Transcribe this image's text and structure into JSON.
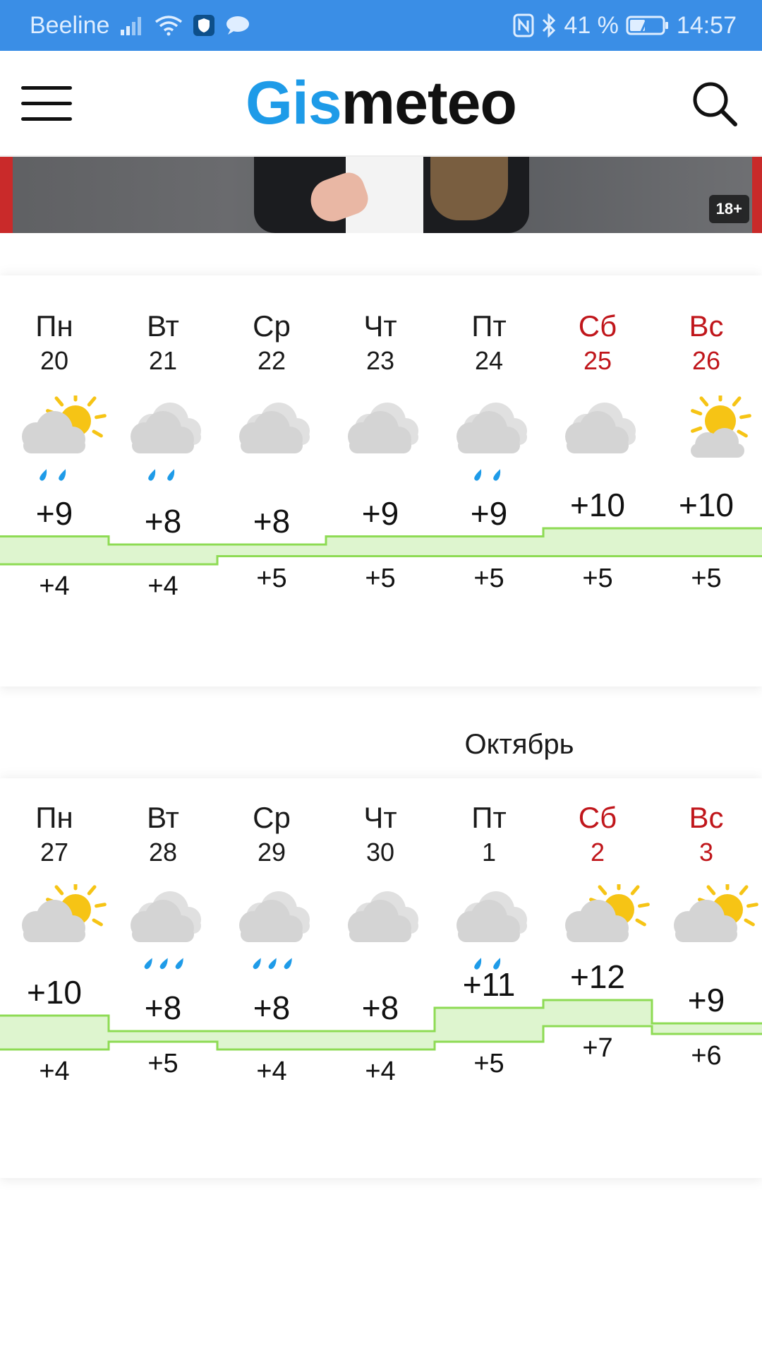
{
  "status_bar": {
    "carrier": "Beeline",
    "battery": "41 %",
    "time": "14:57"
  },
  "header": {
    "logo_part1": "Gis",
    "logo_part2": "meteo"
  },
  "ad": {
    "age_badge": "18+"
  },
  "month_label": "Октябрь",
  "colors": {
    "status_bar": "#3a8ee6",
    "logo_blue": "#1e9be8",
    "weekend": "#c0161b",
    "temp_band_fill": "#def5cf",
    "temp_band_line": "#8edb54",
    "rain": "#1e9be8",
    "sun": "#f6c415",
    "cloud": "#d4d4d4"
  },
  "weeks": [
    {
      "days": [
        {
          "name": "Пн",
          "num": "20",
          "icon": "partly-cloudy-rain-icon",
          "max": "+9",
          "min": "+4",
          "weekend": false,
          "hi": 9,
          "lo": 4
        },
        {
          "name": "Вт",
          "num": "21",
          "icon": "cloudy-rain-icon",
          "max": "+8",
          "min": "+4",
          "weekend": false,
          "hi": 8,
          "lo": 4
        },
        {
          "name": "Ср",
          "num": "22",
          "icon": "cloudy-icon",
          "max": "+8",
          "min": "+5",
          "weekend": false,
          "hi": 8,
          "lo": 5
        },
        {
          "name": "Чт",
          "num": "23",
          "icon": "cloudy-icon",
          "max": "+9",
          "min": "+5",
          "weekend": false,
          "hi": 9,
          "lo": 5
        },
        {
          "name": "Пт",
          "num": "24",
          "icon": "cloudy-rain-icon",
          "max": "+9",
          "min": "+5",
          "weekend": false,
          "hi": 9,
          "lo": 5
        },
        {
          "name": "Сб",
          "num": "25",
          "icon": "cloudy-icon",
          "max": "+10",
          "min": "+5",
          "weekend": true,
          "hi": 10,
          "lo": 5
        },
        {
          "name": "Вс",
          "num": "26",
          "icon": "sun-behind-cloud-icon",
          "max": "+10",
          "min": "+5",
          "weekend": true,
          "hi": 10,
          "lo": 5
        }
      ]
    },
    {
      "days": [
        {
          "name": "Пн",
          "num": "27",
          "icon": "partly-cloudy-icon",
          "max": "+10",
          "min": "+4",
          "weekend": false,
          "hi": 10,
          "lo": 4
        },
        {
          "name": "Вт",
          "num": "28",
          "icon": "cloudy-heavy-rain-icon",
          "max": "+8",
          "min": "+5",
          "weekend": false,
          "hi": 8,
          "lo": 5
        },
        {
          "name": "Ср",
          "num": "29",
          "icon": "cloudy-heavy-rain-icon",
          "max": "+8",
          "min": "+4",
          "weekend": false,
          "hi": 8,
          "lo": 4
        },
        {
          "name": "Чт",
          "num": "30",
          "icon": "cloudy-icon",
          "max": "+8",
          "min": "+4",
          "weekend": false,
          "hi": 8,
          "lo": 4
        },
        {
          "name": "Пт",
          "num": "1",
          "icon": "cloudy-rain-icon",
          "max": "+11",
          "min": "+5",
          "weekend": false,
          "hi": 11,
          "lo": 5
        },
        {
          "name": "Сб",
          "num": "2",
          "icon": "partly-cloudy-icon",
          "max": "+12",
          "min": "+7",
          "weekend": true,
          "hi": 12,
          "lo": 7
        },
        {
          "name": "Вс",
          "num": "3",
          "icon": "partly-cloudy-icon",
          "max": "+9",
          "min": "+6",
          "weekend": true,
          "hi": 9,
          "lo": 6
        }
      ]
    }
  ]
}
